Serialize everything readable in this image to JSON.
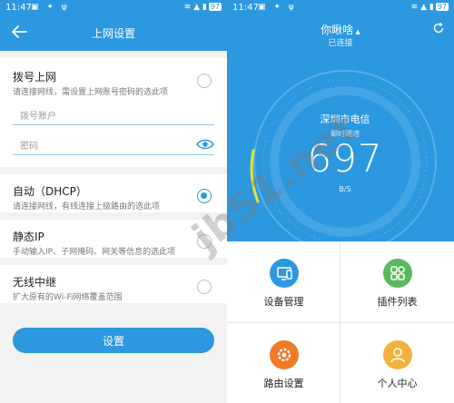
{
  "left": {
    "status": {
      "time": "11:47",
      "battery": "97"
    },
    "header": {
      "title": "上网设置"
    },
    "dialup": {
      "title": "拨号上网",
      "desc": "请连接网线，需设置上网账号密码的选此项",
      "account_placeholder": "拨号账户",
      "password_placeholder": "密码"
    },
    "dhcp": {
      "title": "自动（DHCP）",
      "desc": "请连接网线，有线连接上级路由的选此项",
      "selected": true
    },
    "static": {
      "title": "静态IP",
      "desc": "手动输入IP、子网掩码、网关等信息的选此项"
    },
    "relay": {
      "title": "无线中继",
      "desc": "扩大原有的Wi-Fi网络覆盖范围"
    },
    "setup_button": "设置"
  },
  "right": {
    "status": {
      "time": "11:47",
      "battery": "97"
    },
    "device_name": "你瞅啥",
    "connection_status": "已连接",
    "isp": "深圳市电信",
    "speed_label": "即时网速",
    "speed_value": "697",
    "speed_unit": "B/S",
    "tiles": [
      {
        "label": "设备管理",
        "icon": "device-manage-icon",
        "color": "#2c98e0"
      },
      {
        "label": "插件列表",
        "icon": "plugin-list-icon",
        "color": "#5cb85c"
      },
      {
        "label": "路由设置",
        "icon": "router-settings-icon",
        "color": "#f07a2a"
      },
      {
        "label": "个人中心",
        "icon": "personal-center-icon",
        "color": "#f3b23e"
      }
    ]
  },
  "watermark": "jb51.net",
  "colors": {
    "primary": "#2c98e0",
    "gauge_arc": "#e7e32b"
  }
}
